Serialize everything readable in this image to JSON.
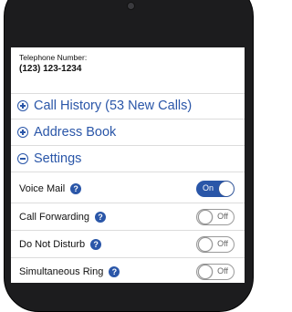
{
  "account": {
    "telephone_label": "Telephone Number:",
    "telephone_number": "(123) 123-1234"
  },
  "sections": [
    {
      "label": "Call History (53 New Calls)",
      "icon": "plus-circle-icon",
      "expanded": false
    },
    {
      "label": "Address Book",
      "icon": "plus-circle-icon",
      "expanded": false
    },
    {
      "label": "Settings",
      "icon": "minus-circle-icon",
      "expanded": true
    }
  ],
  "settings": [
    {
      "label": "Voice Mail",
      "state": "On",
      "enabled": true
    },
    {
      "label": "Call Forwarding",
      "state": "Off",
      "enabled": false
    },
    {
      "label": "Do Not Disturb",
      "state": "Off",
      "enabled": false
    },
    {
      "label": "Simultaneous Ring",
      "state": "Off",
      "enabled": false
    }
  ],
  "help_glyph": "?",
  "colors": {
    "accent": "#2a56a8",
    "phone_frame": "#1c1c1e",
    "screen_bg": "#ffffff",
    "divider": "#dcdcdc"
  }
}
